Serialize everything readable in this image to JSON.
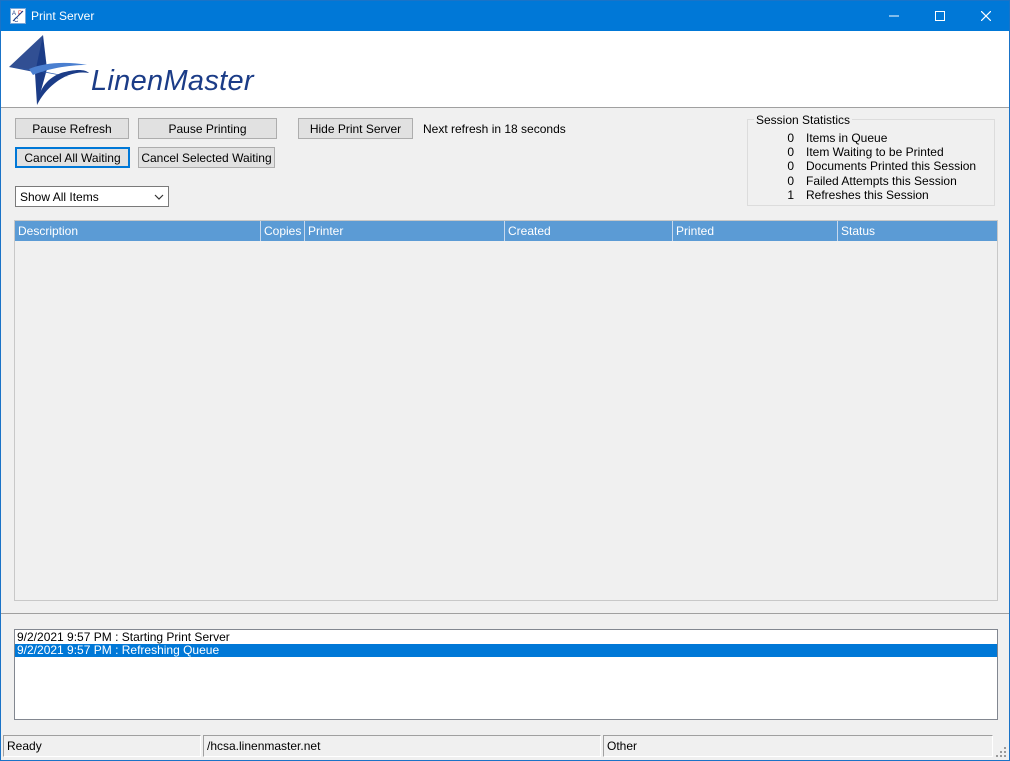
{
  "window": {
    "title": "Print Server",
    "icon": "apc-app-icon",
    "controls": {
      "minimize": "minimize-icon",
      "maximize": "maximize-icon",
      "close": "close-icon"
    }
  },
  "logo": {
    "text": "LinenMaster",
    "colors": {
      "brand": "#1b3c87"
    }
  },
  "toolbar": {
    "pause_refresh": "Pause Refresh",
    "pause_printing": "Pause Printing",
    "hide_print_server": "Hide Print Server",
    "cancel_all_waiting": "Cancel All Waiting",
    "cancel_selected_waiting": "Cancel Selected Waiting",
    "refresh_status": "Next refresh in 18 seconds"
  },
  "filter": {
    "selected": "Show All Items"
  },
  "session_statistics": {
    "title": "Session Statistics",
    "rows": [
      {
        "value": "0",
        "label": "Items in Queue"
      },
      {
        "value": "0",
        "label": "Item Waiting to be Printed"
      },
      {
        "value": "0",
        "label": "Documents Printed this Session"
      },
      {
        "value": "0",
        "label": "Failed Attempts this Session"
      },
      {
        "value": "1",
        "label": "Refreshes this Session"
      }
    ]
  },
  "queue_grid": {
    "columns": [
      "Description",
      "Copies",
      "Printer",
      "Created",
      "Printed",
      "Status"
    ],
    "rows": [],
    "header_color": "#5b9bd5"
  },
  "log": {
    "entries": [
      {
        "text": "9/2/2021 9:57 PM : Starting Print Server",
        "selected": false
      },
      {
        "text": "9/2/2021 9:57 PM : Refreshing Queue",
        "selected": true
      }
    ],
    "selection_color": "#0078d7"
  },
  "statusbar": {
    "status": "Ready",
    "server": "/hcsa.linenmaster.net",
    "other": "Other"
  },
  "colors": {
    "titlebar": "#0078d7",
    "accent": "#0078d7"
  }
}
